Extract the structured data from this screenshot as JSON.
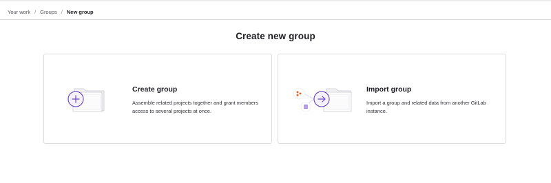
{
  "breadcrumb": {
    "items": [
      {
        "label": "Your work"
      },
      {
        "label": "Groups"
      },
      {
        "label": "New group"
      }
    ],
    "separator": "/"
  },
  "page_title": "Create new group",
  "cards": [
    {
      "title": "Create group",
      "description": "Assemble related projects together and grant members access to several projects at once.",
      "icon": "folder-plus-icon"
    },
    {
      "title": "Import group",
      "description": "Import a group and related data from another GitLab instance.",
      "icon": "folder-import-icon"
    }
  ],
  "colors": {
    "accent": "#6e49cb",
    "accent_light": "#e9e3f8",
    "orange": "#e2632a",
    "border": "#dcdcde",
    "text": "#1f1e24"
  }
}
